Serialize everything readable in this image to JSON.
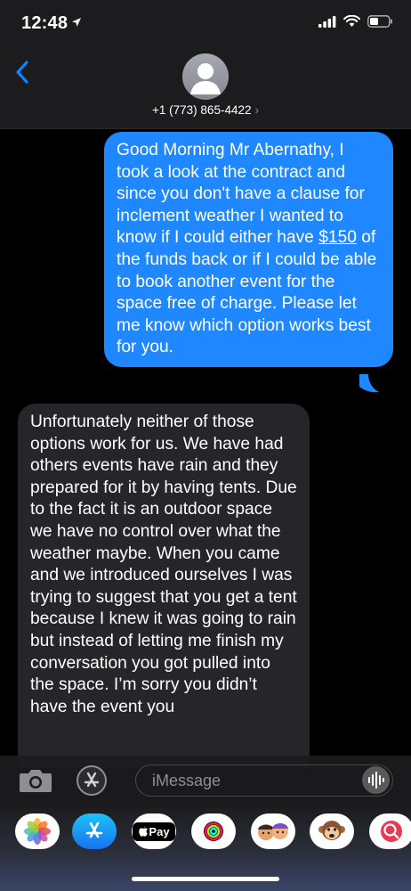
{
  "status": {
    "time": "12:48"
  },
  "header": {
    "contact": "+1 (773) 865-4422"
  },
  "messages": {
    "outgoing": {
      "before": "Good Morning Mr Abernathy, I took a look at the contract and since you don't have a clause for inclement weather I wanted to know if I could either have ",
      "amount": "$150",
      "after": " of the funds back or if I could be able to book another event for the space free of charge. Please let me know which option works best for you."
    },
    "incoming": {
      "text": "Unfortunately neither of those options work for us. We have had others events have rain and they prepared for it by having tents. Due to the fact it is an outdoor space we have no control over what the weather maybe. When you came and we introduced ourselves I was trying to suggest that you get a tent because I knew it was going to rain but instead of letting me finish my conversation you got pulled into the space. I’m sorry you didn’t have the event you"
    }
  },
  "composer": {
    "placeholder": "iMessage"
  },
  "app_tray": {
    "apple_pay_label": "Pay",
    "icons": [
      "photos-icon",
      "app-store-icon",
      "apple-pay-icon",
      "activity-icon",
      "memoji-icon",
      "animoji-icon",
      "web-search-icon"
    ]
  },
  "colors": {
    "outgoing_bubble": "#1f87ff",
    "incoming_bubble": "#26262a",
    "accent": "#0a84ff"
  }
}
